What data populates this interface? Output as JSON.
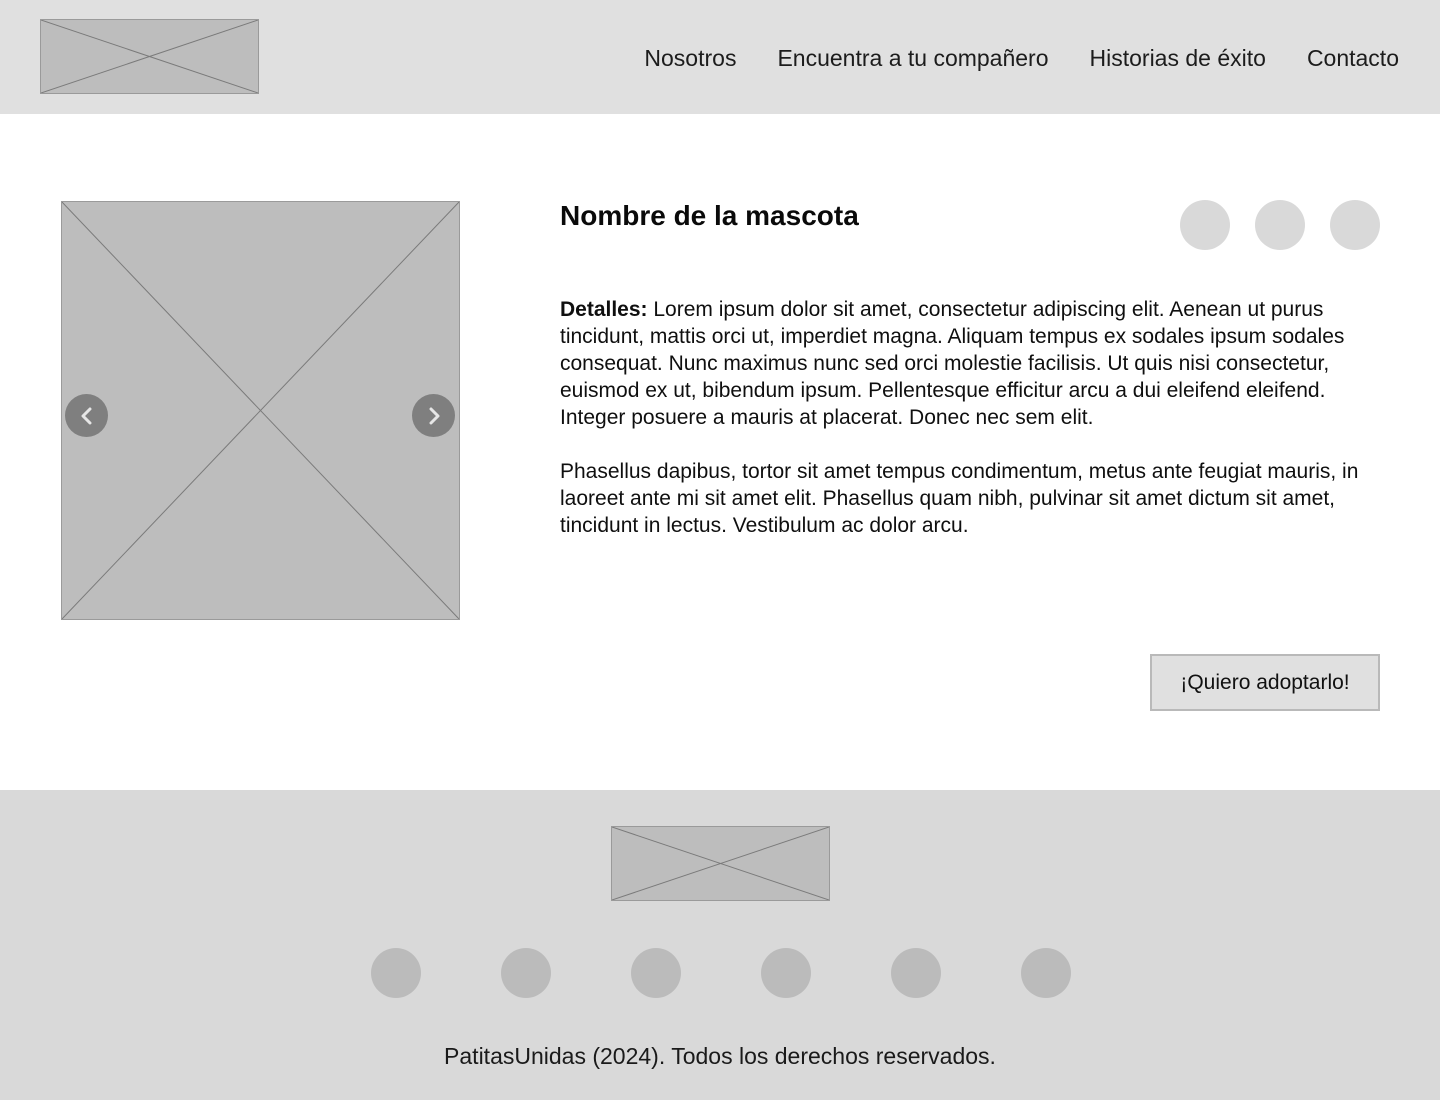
{
  "header": {
    "logo": "logo-placeholder",
    "nav": [
      {
        "label": "Nosotros"
      },
      {
        "label": "Encuentra a tu compañero"
      },
      {
        "label": "Historias de éxito"
      },
      {
        "label": "Contacto"
      }
    ]
  },
  "pet": {
    "name": "Nombre de la mascota",
    "image": "image-placeholder",
    "prev_icon": "chevron-left-icon",
    "next_icon": "chevron-right-icon",
    "share_icons": [
      "circle-icon",
      "circle-icon",
      "circle-icon"
    ],
    "details_label": "Detalles:",
    "details_text": " Lorem ipsum dolor sit amet, consectetur adipiscing elit. Aenean ut  purus tincidunt, mattis orci ut, imperdiet magna. Aliquam tempus ex sodales ipsum sodales consequat. Nunc maximus nunc sed orci molestie facilisis. Ut quis nisi consectetur, euismod ex ut, bibendum ipsum. Pellentesque efficitur arcu a dui eleifend eleifend. Integer posuere a mauris at placerat. Donec nec sem elit.",
    "paragraph_2": "Phasellus dapibus, tortor sit amet tempus condimentum, metus ante feugiat mauris, in laoreet ante mi sit amet elit. Phasellus quam nibh, pulvinar sit amet dictum sit amet, tincidunt in lectus. Vestibulum ac dolor arcu.",
    "adopt_button": "¡Quiero adoptarlo!"
  },
  "footer": {
    "logo": "logo-placeholder",
    "social_icons": [
      "circle-icon",
      "circle-icon",
      "circle-icon",
      "circle-icon",
      "circle-icon",
      "circle-icon"
    ],
    "copyright": "PatitasUnidas (2024). Todos los derechos reservados."
  },
  "colors": {
    "header_bg": "#e0e0e0",
    "footer_bg": "#d9d9d9",
    "placeholder": "#bdbdbd",
    "arrow_bg": "#7f7f7f",
    "button_bg": "#e0e0e0"
  }
}
